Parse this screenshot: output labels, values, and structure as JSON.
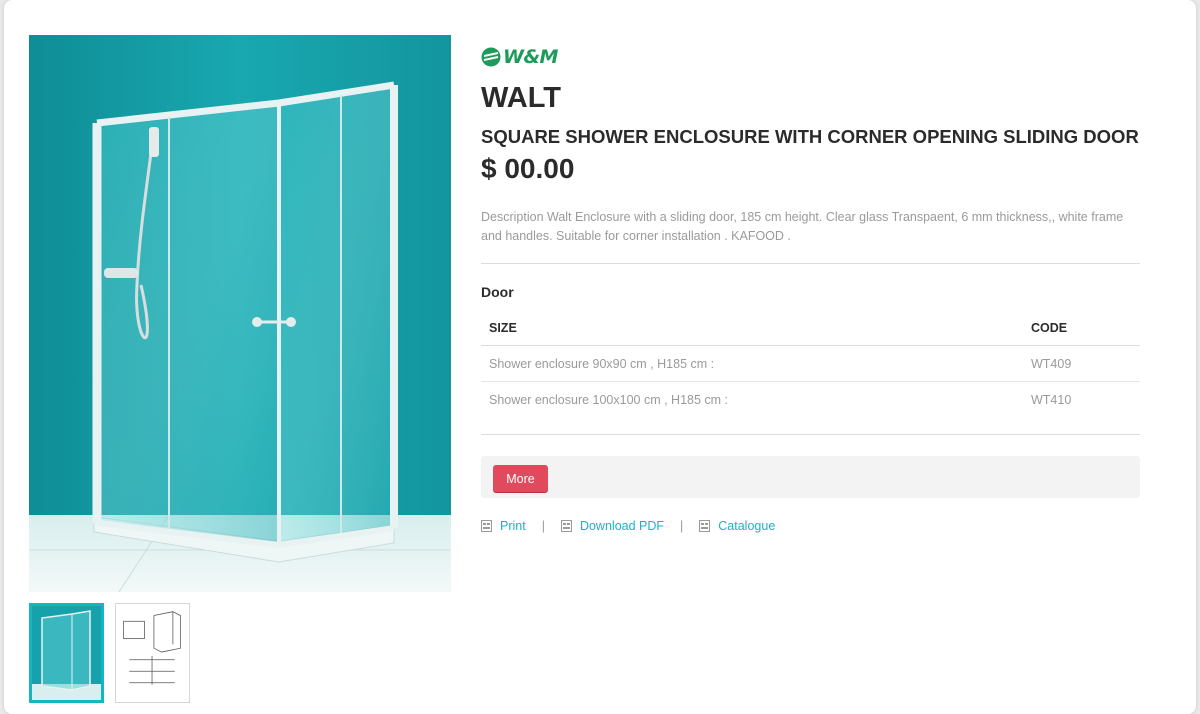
{
  "brand": {
    "name": "W&M",
    "color": "#1e9a5a"
  },
  "product": {
    "name": "WALT",
    "subtitle": "SQUARE SHOWER ENCLOSURE WITH CORNER OPENING SLIDING DOOR",
    "price": "$ 00.00",
    "description": "Description Walt Enclosure with a sliding door, 185 cm height. Clear glass Transpaent, 6 mm thickness,, white frame and handles. Suitable for corner installation . KAFOOD ."
  },
  "specs": {
    "section_title": "Door",
    "columns": {
      "size": "SIZE",
      "code": "CODE"
    },
    "rows": [
      {
        "size": "Shower enclosure 90x90 cm , H185 cm :",
        "code": "WT409"
      },
      {
        "size": "Shower enclosure 100x100 cm , H185 cm :",
        "code": "WT410"
      }
    ]
  },
  "more_button": {
    "label": "More",
    "color": "#e04a5c"
  },
  "actions": {
    "print": "Print",
    "download_pdf": "Download PDF",
    "catalogue": "Catalogue",
    "separator": "|",
    "link_color": "#1ab3c8"
  },
  "icons": [
    "wm-logo-icon",
    "print-icon",
    "pdf-icon",
    "catalogue-icon"
  ],
  "colors": {
    "accent": "#15b5c2",
    "photo_bg": "#1aa0a8"
  }
}
